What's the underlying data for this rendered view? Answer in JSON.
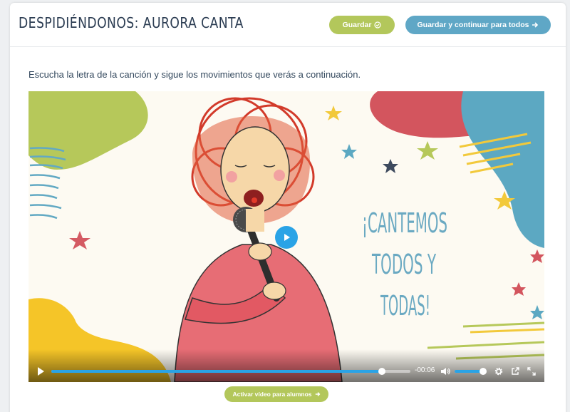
{
  "header": {
    "title": "DESPIDIÉNDONOS: AURORA CANTA",
    "save_label": "Guardar",
    "save_icon": "check-circle-icon",
    "save_all_label": "Guardar y continuar para todos",
    "save_all_icon": "arrow-right-icon"
  },
  "main": {
    "instructions": "Escucha la letra de la canción y sigue los movimientos que verás a continuación."
  },
  "video": {
    "text_lines": [
      "¡CANTEMOS",
      "TODOS Y",
      "TODAS!"
    ],
    "time_remaining": "-00:06",
    "progress": 0.92,
    "volume": 0.9,
    "activate_label": "Activar vídeo para alumnos",
    "activate_icon": "arrow-right-icon"
  },
  "colors": {
    "green": "#b3c75b",
    "blue": "#5fa7c6",
    "accent": "#2aa3e6",
    "title": "#2b3c52"
  }
}
